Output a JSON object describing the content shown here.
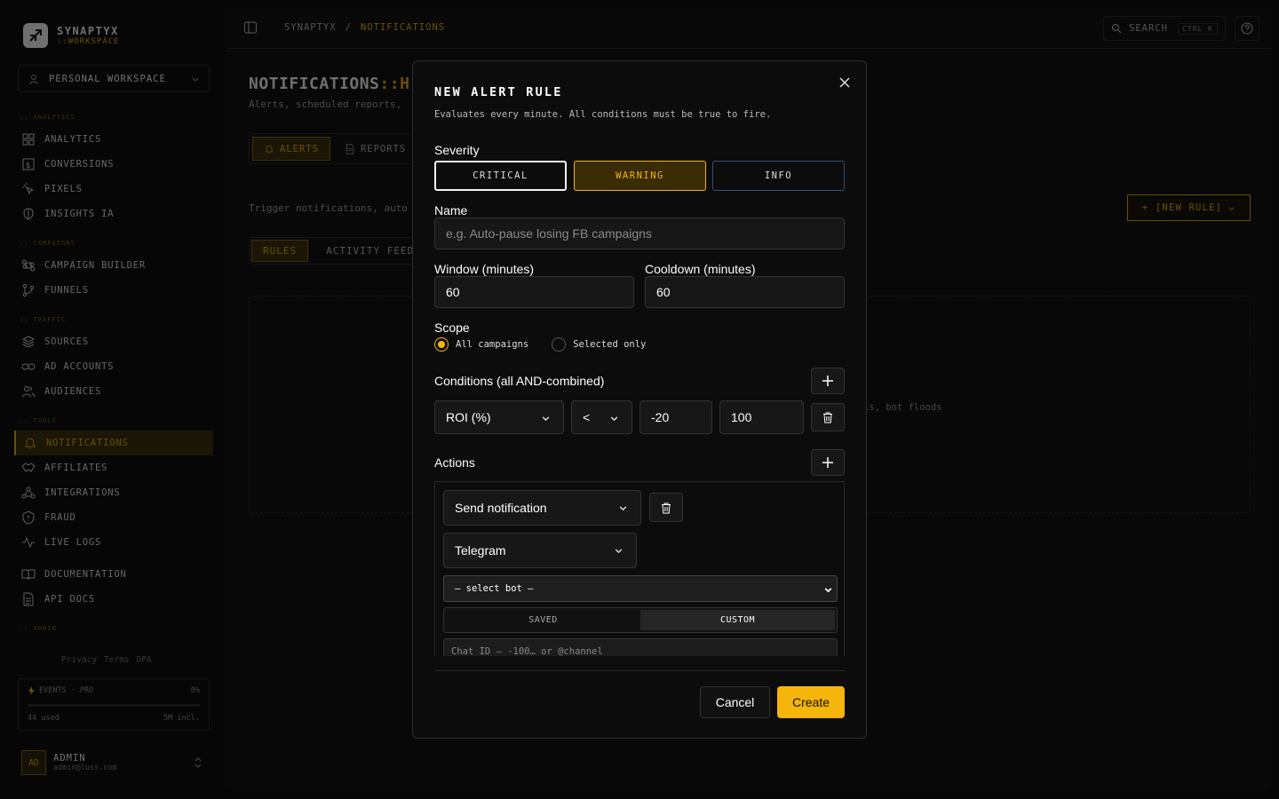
{
  "brand": {
    "name": "SYNAPTYX",
    "sub": "::WORKSPACE"
  },
  "workspace": {
    "label": "PERSONAL WORKSPACE"
  },
  "sidebar": {
    "sections": [
      ":: ANALYTICS",
      ":: CAMPAIGNS",
      ":: TRAFFIC",
      ":: TOOLS",
      ":: ADMIN"
    ],
    "items": [
      {
        "label": "ANALYTICS"
      },
      {
        "label": "CONVERSIONS"
      },
      {
        "label": "PIXELS"
      },
      {
        "label": "INSIGHTS IA"
      },
      {
        "label": "CAMPAIGN BUILDER"
      },
      {
        "label": "FUNNELS"
      },
      {
        "label": "SOURCES"
      },
      {
        "label": "AD ACCOUNTS"
      },
      {
        "label": "AUDIENCES"
      },
      {
        "label": "NOTIFICATIONS"
      },
      {
        "label": "AFFILIATES"
      },
      {
        "label": "INTEGRATIONS"
      },
      {
        "label": "FRAUD"
      },
      {
        "label": "LIVE LOGS"
      },
      {
        "label": "DOCUMENTATION"
      },
      {
        "label": "API DOCS"
      }
    ],
    "legal": [
      "Privacy",
      "Terms",
      "DPA"
    ],
    "events": {
      "label": "EVENTS · PRO",
      "percent": "0%",
      "used": "44 used",
      "included": "5M incl."
    },
    "user": {
      "initials": "AD",
      "name": "ADMIN",
      "email": "admin@luss.com"
    }
  },
  "header": {
    "crumbs": [
      "SYNAPTYX",
      "/",
      "NOTIFICATIONS"
    ],
    "search": "SEARCH",
    "shortcut": "CTRL K"
  },
  "page": {
    "title_a": "NOTIFICATIONS",
    "title_b": "::H",
    "subtitle": "Alerts, scheduled reports,",
    "tabs": [
      "ALERTS",
      "REPORTS"
    ],
    "description": "Trigger notifications, auto",
    "new_rule": "+ [NEW RULE]",
    "subtabs": [
      "RULES",
      "ACTIVITY FEED"
    ],
    "empty_text": "is, bot floods"
  },
  "modal": {
    "title": "NEW ALERT RULE",
    "description": "Evaluates every minute. All conditions must be true to fire.",
    "severity_label": "Severity",
    "severity": [
      "CRITICAL",
      "WARNING",
      "INFO"
    ],
    "name_label": "Name",
    "name_placeholder": "e.g. Auto-pause losing FB campaigns",
    "window_label": "Window (minutes)",
    "window_value": "60",
    "cooldown_label": "Cooldown (minutes)",
    "cooldown_value": "60",
    "scope_label": "Scope",
    "scope_options": [
      "All campaigns",
      "Selected only"
    ],
    "conditions_label": "Conditions (all AND-combined)",
    "condition": {
      "metric": "ROI (%)",
      "operator": "<",
      "value": "-20",
      "threshold": "100"
    },
    "actions_label": "Actions",
    "action": {
      "type": "Send notification",
      "channel": "Telegram",
      "bot": "— select bot —",
      "mode": [
        "SAVED",
        "CUSTOM"
      ],
      "chat_placeholder": "Chat ID  —  -100… or @channel"
    },
    "cancel": "Cancel",
    "create": "Create"
  },
  "colors": {
    "accent": "#f5b50a",
    "background": "#060606",
    "panel": "#0c0c0c",
    "info_border": "#31506e"
  }
}
